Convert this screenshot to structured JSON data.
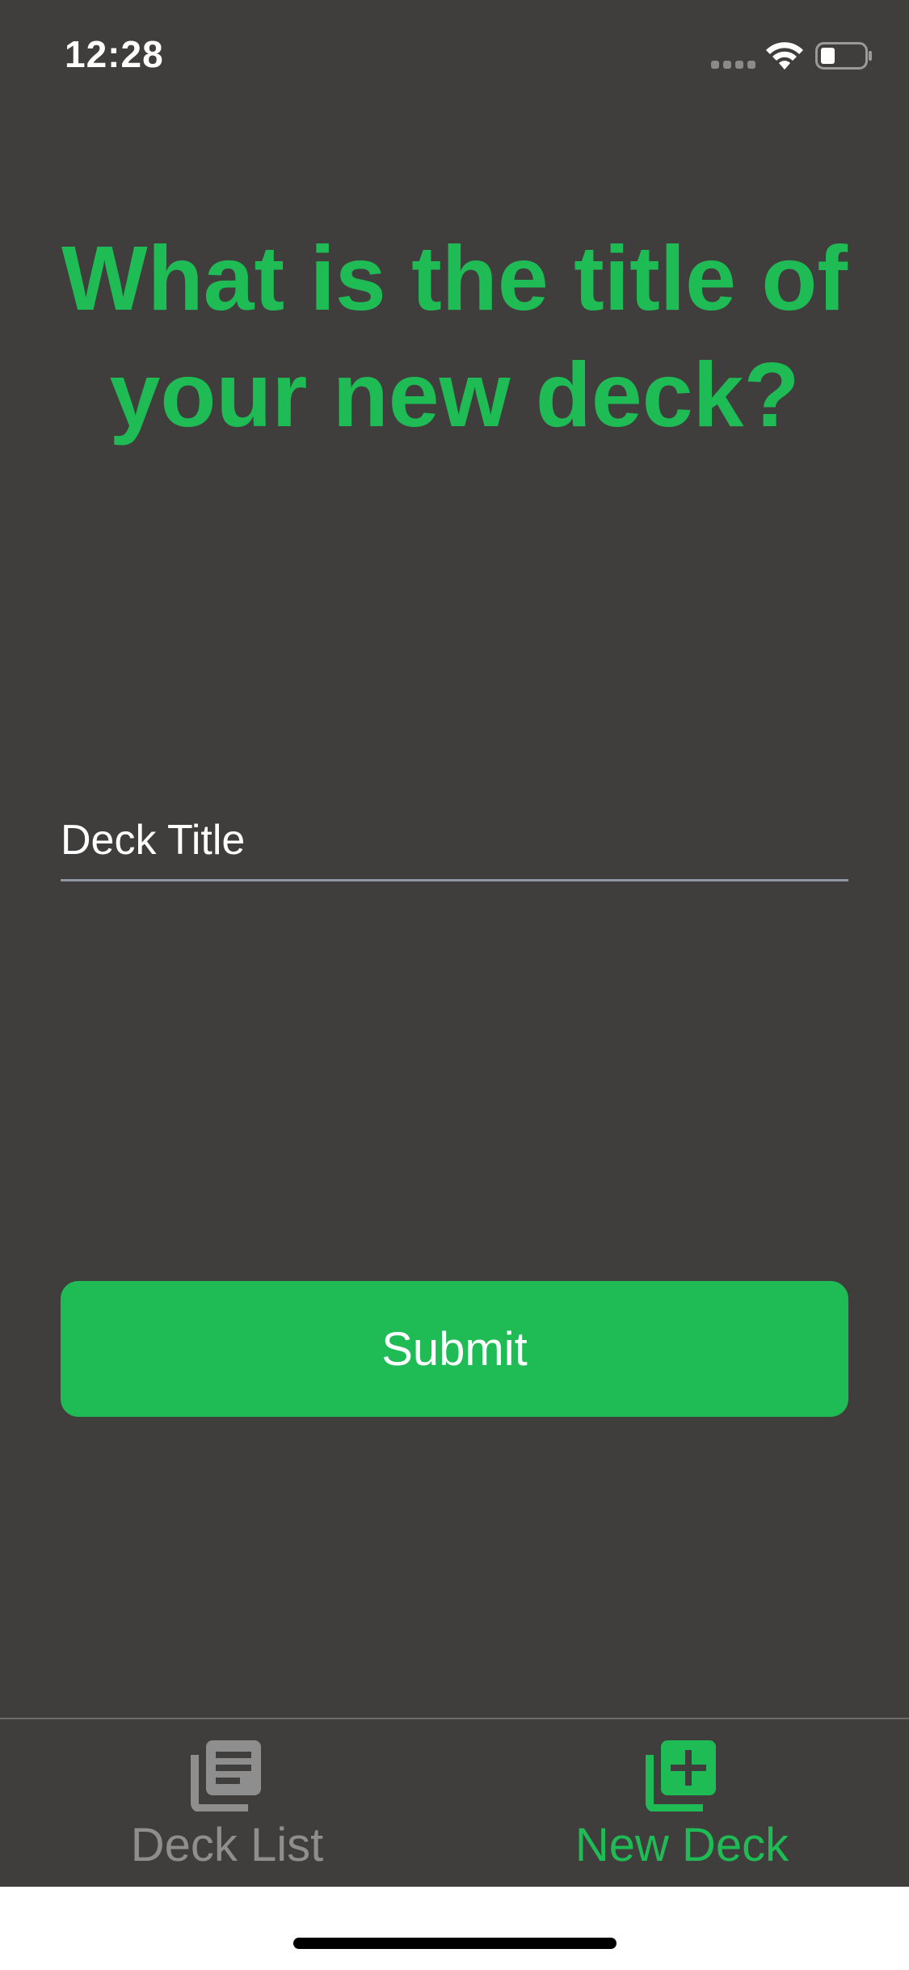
{
  "status_bar": {
    "time": "12:28"
  },
  "main": {
    "heading": "What is the title of your new deck?",
    "title_input": {
      "value": "",
      "placeholder": "Deck Title"
    },
    "submit_label": "Submit"
  },
  "tab_bar": {
    "tabs": [
      {
        "label": "Deck List",
        "icon": "deck-list-icon",
        "active": false
      },
      {
        "label": "New Deck",
        "icon": "add-deck-icon",
        "active": true
      }
    ]
  },
  "colors": {
    "accent": "#1fbb55",
    "background": "#3f3e3d",
    "inactive": "#8e8e8e",
    "input_underline": "#8e97a3"
  }
}
